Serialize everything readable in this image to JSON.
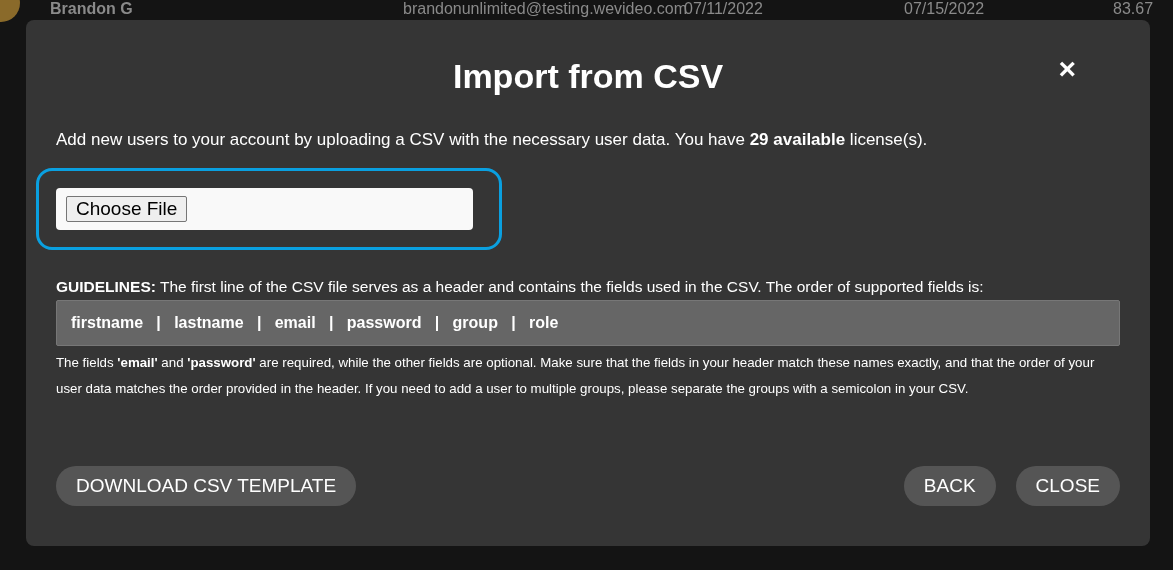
{
  "background_row": {
    "name": "Brandon G",
    "email": "brandonunlimited@testing.wevideo.com",
    "date_1": "07/11/2022",
    "date_2": "07/15/2022",
    "column_5": "83.67"
  },
  "dialog": {
    "title": "Import from CSV",
    "close": "×",
    "description": "Add new users to your account by uploading a CSV with the necessary user data. You have **29 available** license(s).",
    "file_input": {
      "button": "Choose File",
      "focused": true
    },
    "guidelines": "**GUIDELINES:** The first line of the CSV file serves as a header and contains the fields used in the CSV. The order of supported fields is:",
    "fields": "firstname   |   lastname   |   email   |   password   |   group   |   role",
    "note": "The fields **'email'** and **'password'** are required, while the other fields are optional. Make sure that the fields in your header match these names exactly, and that the order of your user data matches the order provided in the header. If you need to add a user to multiple groups, please separate the groups with a semicolon in your CSV.",
    "buttons": [
      {
        "label": "DOWNLOAD CSV TEMPLATE",
        "kind": "left"
      },
      {
        "label": "BACK",
        "kind": "right"
      },
      {
        "label": "CLOSE",
        "kind": "right"
      }
    ]
  }
}
